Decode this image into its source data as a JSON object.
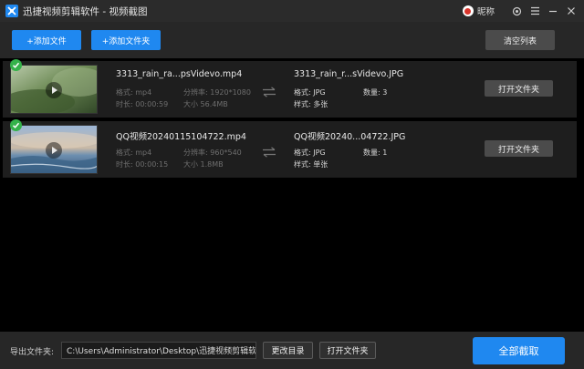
{
  "app": {
    "title": "迅捷视频剪辑软件 - 视频截图",
    "username": "昵称",
    "accent": "#1f88f0"
  },
  "toolbar": {
    "add_file_label": "+添加文件",
    "add_folder_label": "+添加文件夹",
    "clear_list_label": "清空列表"
  },
  "items": [
    {
      "source_name": "3313_rain_ra...psVidevo.mp4",
      "format_label": "格式: mp4",
      "resolution_label": "分辨率: 1920*1080",
      "duration_label": "时长: 00:00:59",
      "size_label": "大小 56.4MB",
      "output_name": "3313_rain_r...sVidevo.JPG",
      "out_format_label": "格式: JPG",
      "count_label": "数量: 3",
      "style_label": "样式: 多张",
      "open_folder_label": "打开文件夹",
      "done": true
    },
    {
      "source_name": "QQ视频20240115104722.mp4",
      "format_label": "格式: mp4",
      "resolution_label": "分辨率: 960*540",
      "duration_label": "时长: 00:00:15",
      "size_label": "大小 1.8MB",
      "output_name": "QQ视频20240...04722.JPG",
      "out_format_label": "格式: JPG",
      "count_label": "数量: 1",
      "style_label": "样式: 单张",
      "open_folder_label": "打开文件夹",
      "done": true
    }
  ],
  "footer": {
    "output_label": "导出文件夹:",
    "output_path": "C:\\Users\\Administrator\\Desktop\\迅捷视频剪辑软件",
    "change_dir_label": "更改目录",
    "open_folder_label": "打开文件夹",
    "capture_all_label": "全部截取"
  }
}
